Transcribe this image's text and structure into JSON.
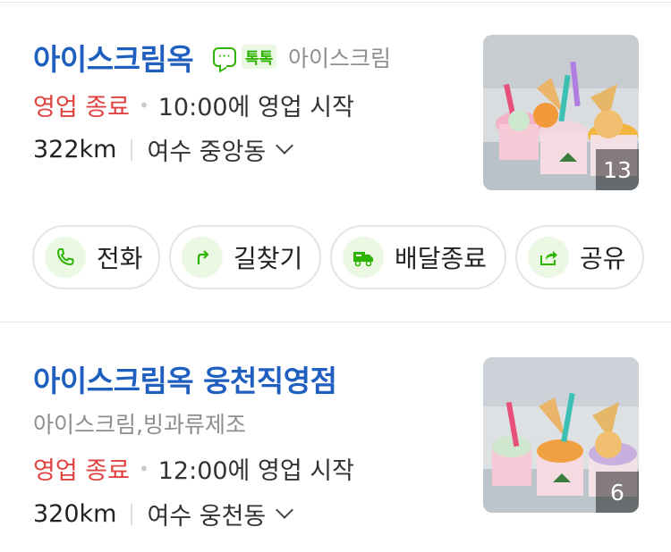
{
  "results": [
    {
      "name": "아이스크림옥",
      "talktalk_label": "톡톡",
      "category": "아이스크림",
      "status": "영업 종료",
      "open_time": "10:00에 영업 시작",
      "distance": "322km",
      "region": "여수 중앙동",
      "photo_count": "13"
    },
    {
      "name": "아이스크림옥 웅천직영점",
      "category": "아이스크림,빙과류제조",
      "status": "영업 종료",
      "open_time": "12:00에 영업 시작",
      "distance": "320km",
      "region": "여수 웅천동",
      "photo_count": "6"
    }
  ],
  "actions": [
    {
      "label": "전화",
      "icon": "phone-icon"
    },
    {
      "label": "길찾기",
      "icon": "directions-icon"
    },
    {
      "label": "배달종료",
      "icon": "delivery-truck-icon"
    },
    {
      "label": "공유",
      "icon": "share-icon"
    }
  ],
  "colors": {
    "title": "#1f5fbf",
    "status_closed": "#e0423f",
    "accent_green": "#2db400"
  }
}
